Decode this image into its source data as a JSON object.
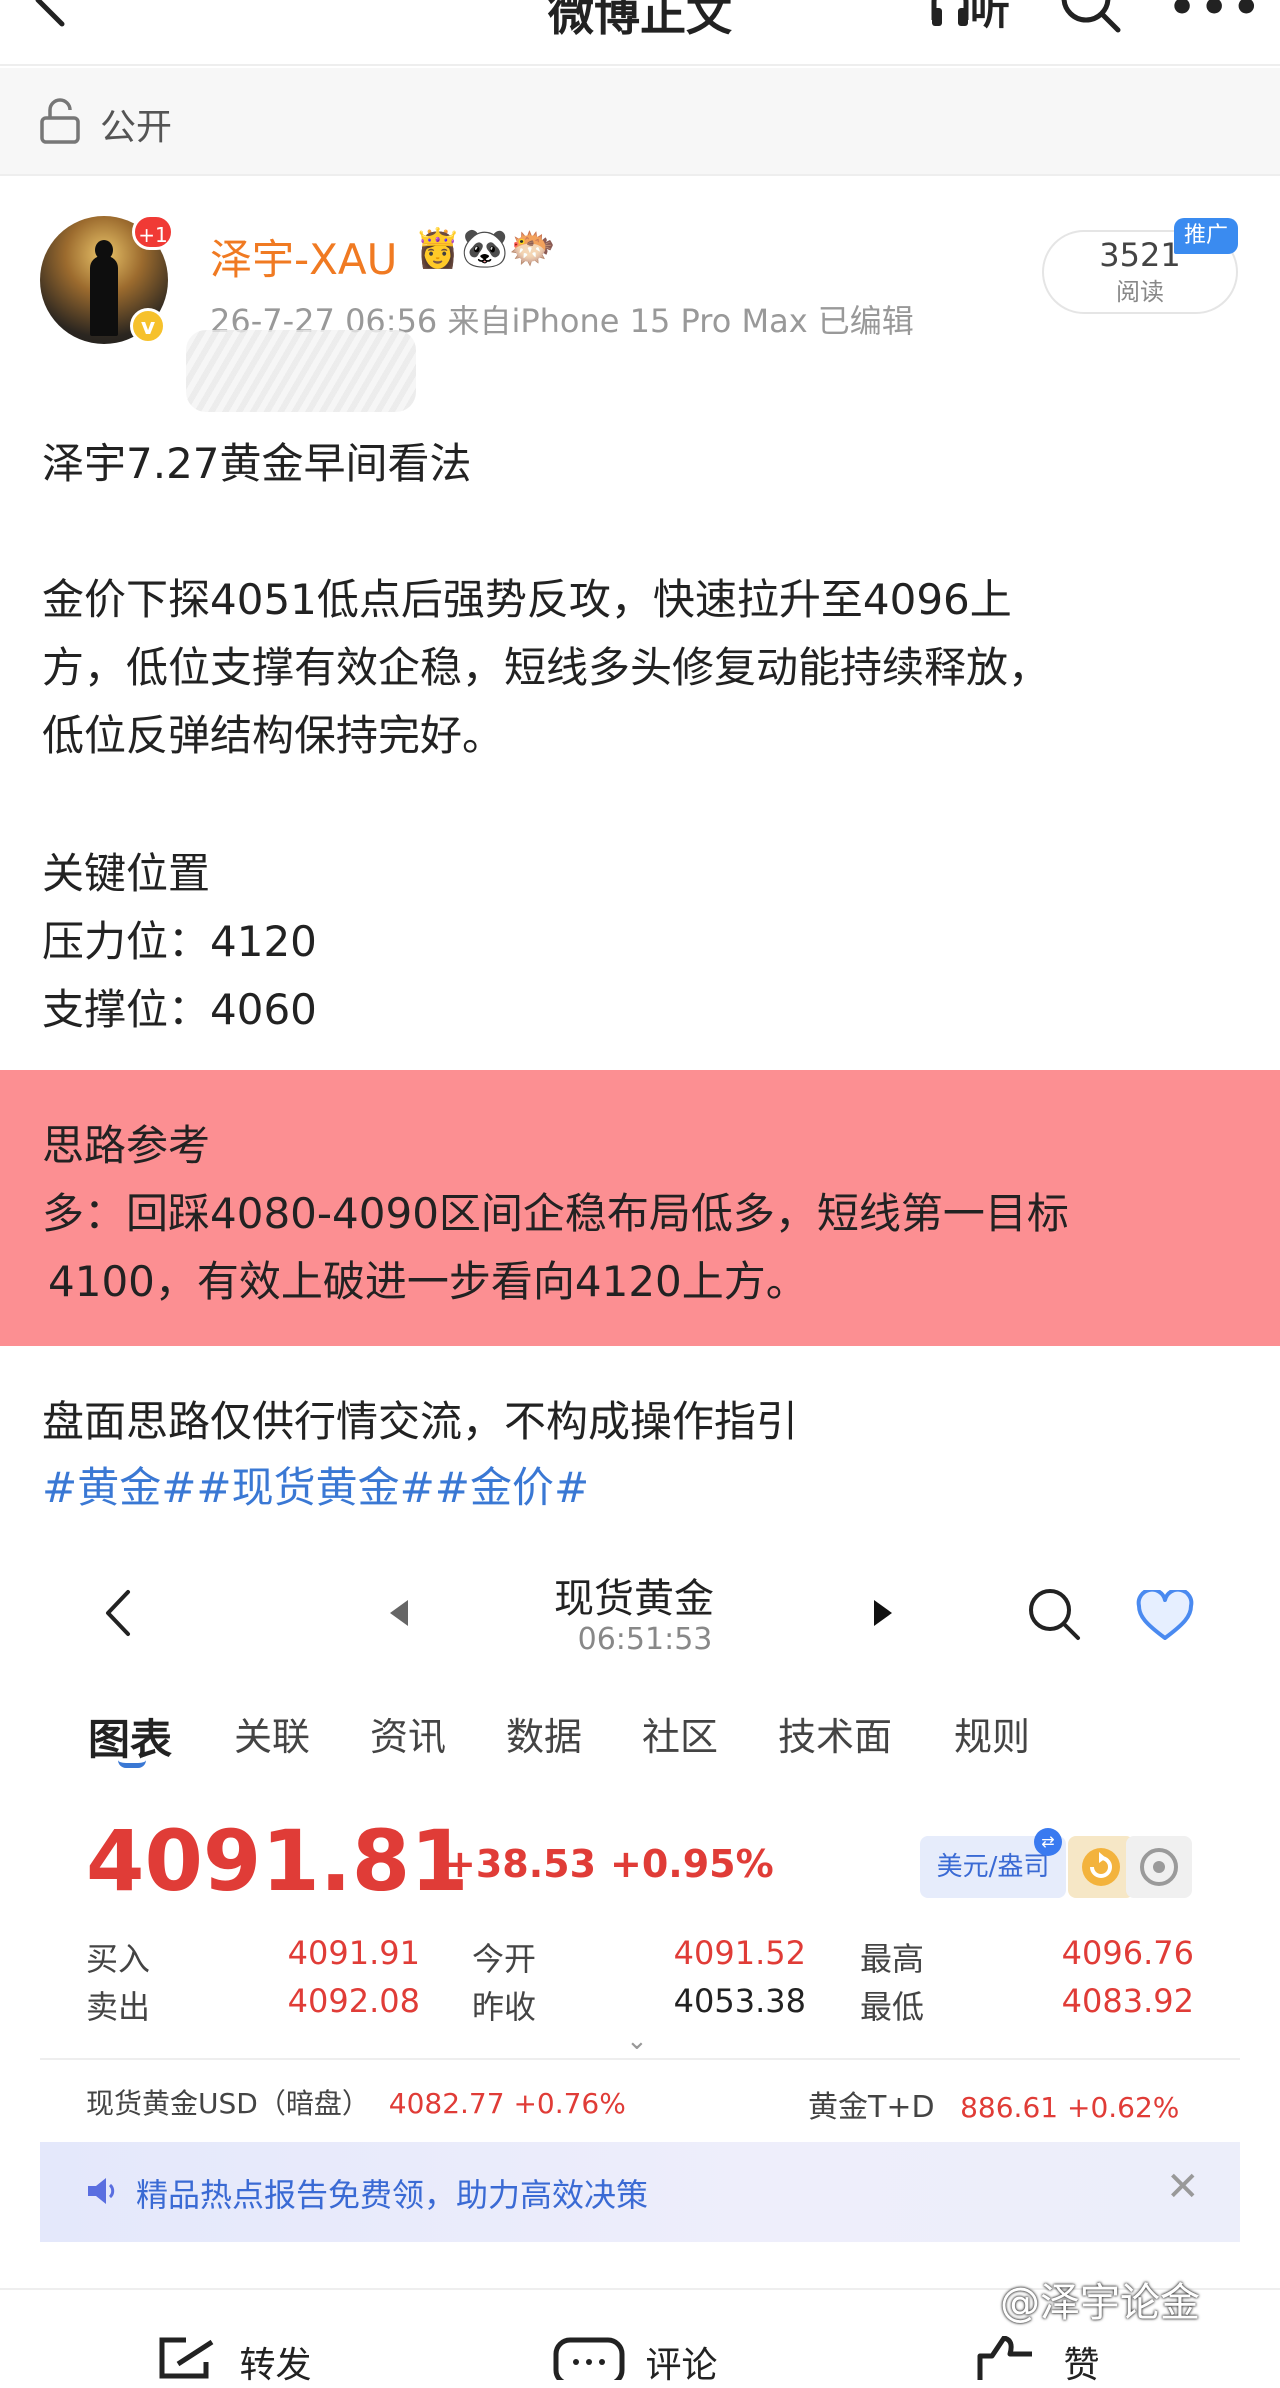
{
  "nav": {
    "title": "微博正文",
    "listen_label": "听"
  },
  "visibility": {
    "label": "公开"
  },
  "author": {
    "name": "泽宇-XAU",
    "emoji": "👸🐼🐡",
    "plus_badge": "+1",
    "verified_badge": "v",
    "meta": "26-7-27 06:56  来自iPhone 15 Pro Max  已编辑"
  },
  "reads": {
    "count": "3521",
    "label": "阅读",
    "promo_label": "推广"
  },
  "post": {
    "title": "泽宇7.27黄金早间看法",
    "para1_line1": "金价下探4051低点后强势反攻，快速拉升至4096上",
    "para1_line2": "方，低位支撑有效企稳，短线多头修复动能持续释放，",
    "para1_line3": "低位反弹结构保持完好。",
    "key_heading": "关键位置",
    "resistance": "压力位：4120",
    "support": "支撑位：4060",
    "idea_heading": "思路参考",
    "idea_line1": "多：回踩4080-4090区间企稳布局低多，短线第一目标",
    "idea_line2": "4100，有效上破进一步看向4120上方。",
    "disclaimer": "盘面思路仅供行情交流，不构成操作指引",
    "topics": "#黄金##现货黄金##金价#"
  },
  "quote_screen": {
    "title": "现货黄金",
    "time": "06:51:53",
    "tabs": [
      "图表",
      "关联",
      "资讯",
      "数据",
      "社区",
      "技术面",
      "规则"
    ],
    "active_tab": 0,
    "price": "4091.81",
    "change": "+38.53",
    "change_pct": "+0.95%",
    "currency_unit": "美元/盎司",
    "buy_label": "买入",
    "buy_value": "4091.91",
    "sell_label": "卖出",
    "sell_value": "4092.08",
    "open_label": "今开",
    "open_value": "4091.52",
    "prev_close_label": "昨收",
    "prev_close_value": "4053.38",
    "high_label": "最高",
    "high_value": "4096.76",
    "low_label": "最低",
    "low_value": "4083.92",
    "ref1_label": "现货黄金USD（暗盘）",
    "ref1_value": "4082.77 +0.76%",
    "ref2_label": "黄金T+D",
    "ref2_value": "886.61 +0.62%",
    "banner_text": "精品热点报告免费领，助力高效决策",
    "accent_color": "#e03c37",
    "link_color": "#3a78d4"
  },
  "bottom_bar": {
    "repost": "转发",
    "comment": "评论",
    "like": "赞"
  },
  "watermark": "@泽宇论金",
  "colors": {
    "author_name": "#f07a22",
    "highlight_bg": "#fc8f92"
  }
}
